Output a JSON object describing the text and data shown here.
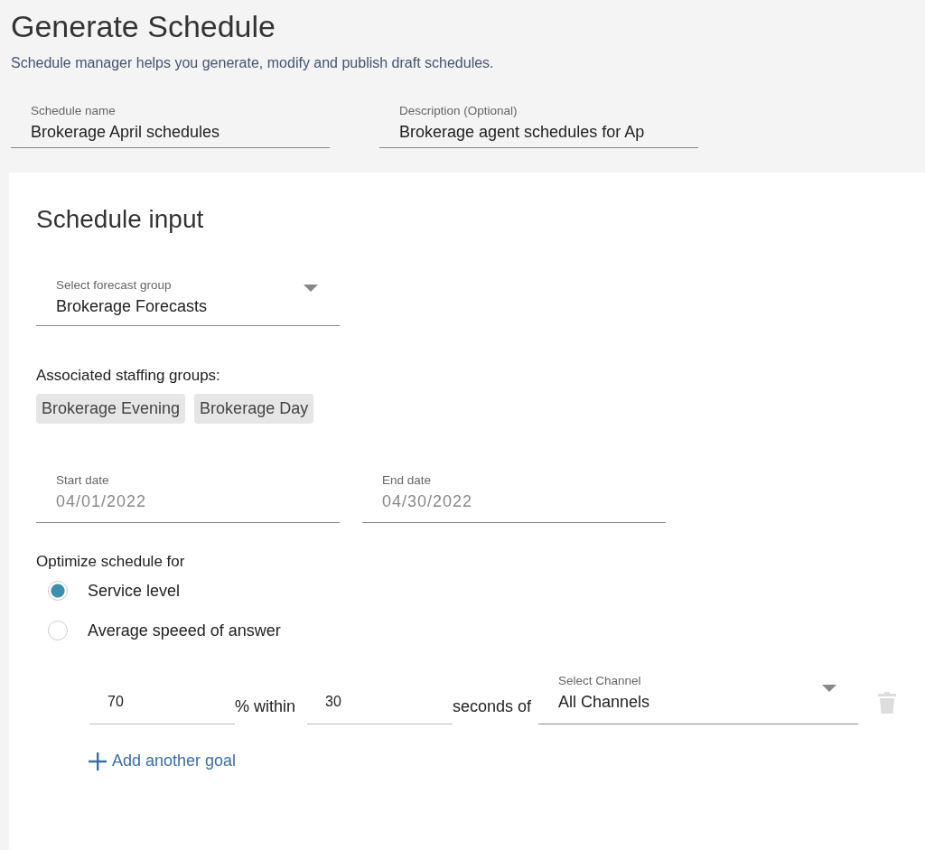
{
  "page": {
    "title": "Generate Schedule",
    "subtitle": "Schedule manager helps you generate, modify and publish draft schedules."
  },
  "header_fields": [
    {
      "label": "Schedule name",
      "value": "Brokerage April schedules"
    },
    {
      "label": "Description (Optional)",
      "value": "Brokerage agent schedules for Ap"
    }
  ],
  "schedule_input": {
    "title": "Schedule input",
    "forecast_group": {
      "label": "Select forecast group",
      "value": "Brokerage Forecasts"
    },
    "staffing_label": "Associated staffing groups:",
    "staffing_groups": [
      "Brokerage Evening",
      "Brokerage Day"
    ],
    "dates": [
      {
        "label": "Start date",
        "value": "04/01/2022",
        "disabled": true
      },
      {
        "label": "End date",
        "value": "04/30/2022",
        "disabled": true
      }
    ],
    "optimize_label": "Optimize schedule for",
    "options": [
      {
        "label": "Service level",
        "selected": true
      },
      {
        "label": "Average speeed of answer",
        "selected": false
      }
    ],
    "goal": {
      "percent": "70",
      "within_text": "% within",
      "seconds": "30",
      "seconds_text": "seconds of",
      "channel_label": "Select Channel",
      "channel_value": "All Channels",
      "delete_disabled": true
    },
    "add_goal": "Add another goal"
  }
}
